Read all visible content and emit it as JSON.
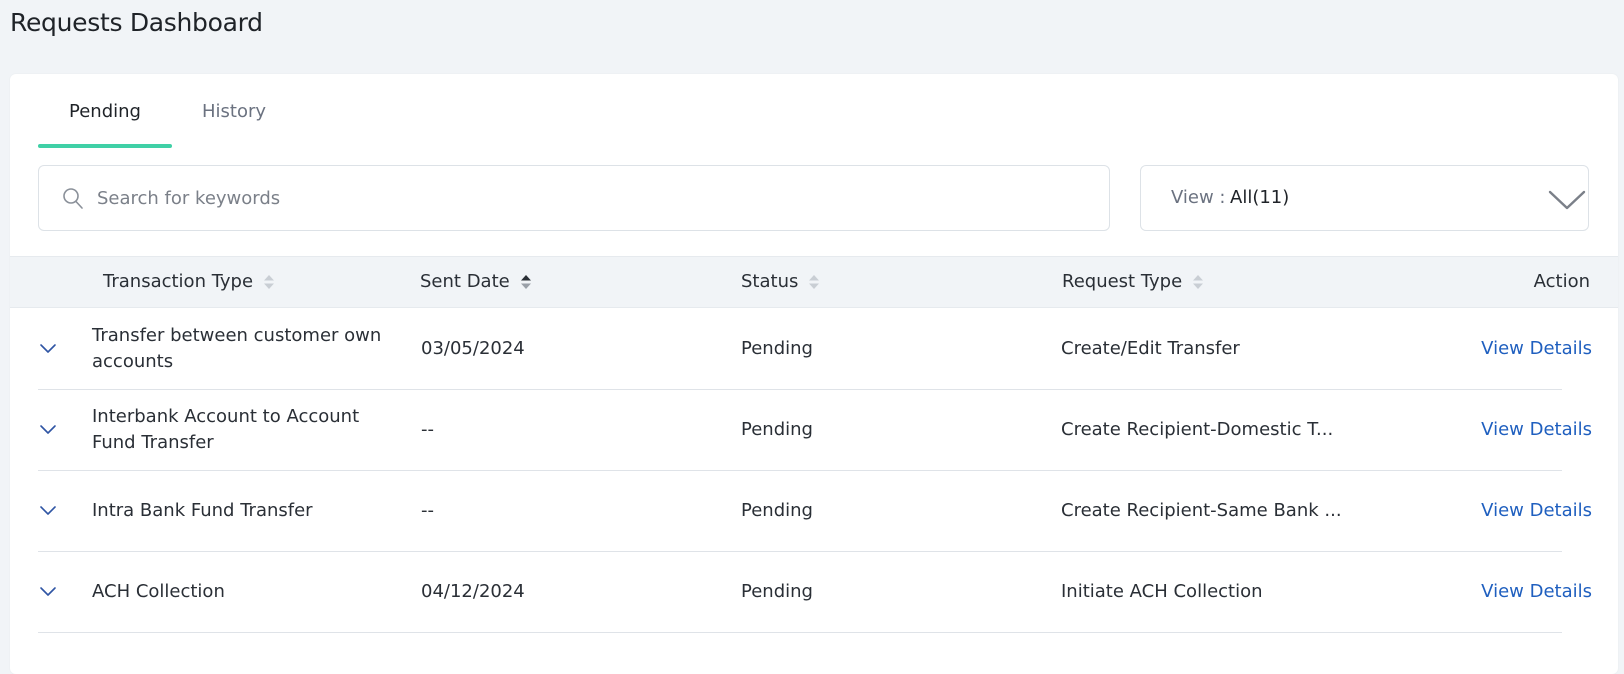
{
  "page": {
    "title": "Requests Dashboard"
  },
  "tabs": [
    {
      "label": "Pending",
      "active": true
    },
    {
      "label": "History",
      "active": false
    }
  ],
  "search": {
    "placeholder": "Search for keywords",
    "value": ""
  },
  "view_filter": {
    "label": "View :",
    "value": "All(11)"
  },
  "table": {
    "columns": [
      {
        "label": "Transaction Type",
        "sortable": true
      },
      {
        "label": "Sent Date",
        "sortable": true,
        "sort_active": true
      },
      {
        "label": "Status",
        "sortable": true
      },
      {
        "label": "Request Type",
        "sortable": true
      },
      {
        "label": "Action",
        "sortable": false
      }
    ],
    "rows": [
      {
        "transaction_type": "Transfer between customer own accounts",
        "sent_date": "03/05/2024",
        "status": "Pending",
        "request_type": "Create/Edit Transfer",
        "action": "View Details"
      },
      {
        "transaction_type": "Interbank Account to Account Fund Transfer",
        "sent_date": "--",
        "status": "Pending",
        "request_type": "Create Recipient-Domestic T...",
        "action": "View Details"
      },
      {
        "transaction_type": "Intra Bank Fund Transfer",
        "sent_date": "--",
        "status": "Pending",
        "request_type": "Create Recipient-Same Bank ...",
        "action": "View Details"
      },
      {
        "transaction_type": "ACH Collection",
        "sent_date": "04/12/2024",
        "status": "Pending",
        "request_type": "Initiate ACH Collection",
        "action": "View Details"
      }
    ]
  },
  "colors": {
    "page_background": "#f1f4f7",
    "tab_accent": "#3fd0a6",
    "link": "#1f5fbf",
    "header_background": "#f1f4f7"
  },
  "icons": {
    "search": "search-icon",
    "view_dropdown": "chevron-down-icon",
    "row_expand": "chevron-down-icon",
    "sort": "sort-icon"
  }
}
